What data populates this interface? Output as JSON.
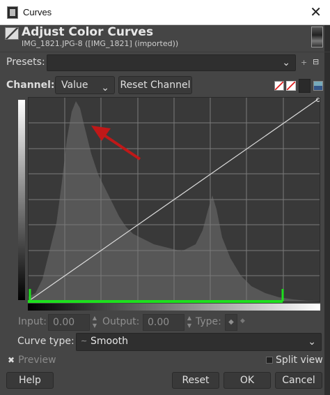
{
  "window": {
    "title": "Curves",
    "close_glyph": "✕"
  },
  "header": {
    "title": "Adjust Color Curves",
    "subtitle": "IMG_1821.JPG-8 ([IMG_1821] (imported))"
  },
  "presets": {
    "label": "Presets:",
    "value": "",
    "add_icon": "+",
    "menu_icon": "⊟"
  },
  "channel": {
    "label": "Channel:",
    "value": "Value",
    "reset_label": "Reset Channel"
  },
  "io": {
    "input_label": "Input:",
    "input_value": "0.00",
    "output_label": "Output:",
    "output_value": "0.00",
    "type_label": "Type:"
  },
  "curve_type": {
    "label": "Curve type:",
    "value": "Smooth"
  },
  "preview": {
    "label": "Preview",
    "checked": true
  },
  "split_view": {
    "label": "Split view",
    "checked": false
  },
  "buttons": {
    "help": "Help",
    "reset": "Reset",
    "ok": "OK",
    "cancel": "Cancel"
  },
  "colors": {
    "highlight_green": "#1de01d",
    "annotation_arrow": "#c01818",
    "grid_line": "#7a7a7a",
    "histogram": "#5a5a5a"
  },
  "icons": {
    "dropdown": "chevron-down-icon",
    "spin": "spin-arrows-icon",
    "curve": "curve-icon"
  }
}
